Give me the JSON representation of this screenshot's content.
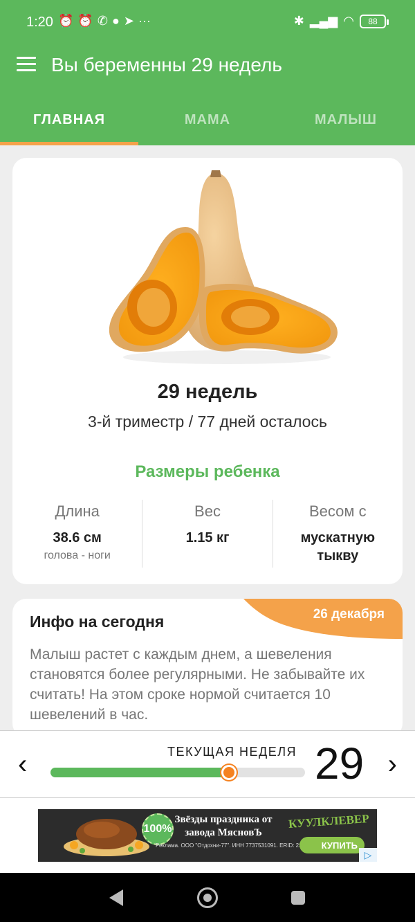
{
  "status_bar": {
    "time": "1:20",
    "left_icons": [
      "alarm-off-icon",
      "alarm-icon",
      "whatsapp-icon",
      "chat-bubble-icon",
      "telegram-icon",
      "more-dots-icon"
    ],
    "right_icons": [
      "bluetooth-icon",
      "signal-icon",
      "wifi-icon"
    ],
    "battery": "88"
  },
  "app_bar": {
    "title": "Вы беременны 29 недель",
    "tabs": [
      {
        "label": "ГЛАВНАЯ",
        "active": true
      },
      {
        "label": "МАМА",
        "active": false
      },
      {
        "label": "МАЛЫШ",
        "active": false
      }
    ]
  },
  "main_card": {
    "image_name": "butternut-squash-image",
    "week_title": "29 недель",
    "trimester_text": "3-й триместр / 77 дней осталось",
    "sizes_title": "Размеры ребенка",
    "metrics": [
      {
        "label": "Длина",
        "value": "38.6 см",
        "sub": "голова - ноги"
      },
      {
        "label": "Вес",
        "value": "1.15 кг",
        "sub": ""
      },
      {
        "label": "Весом с",
        "value_line1": "мускатную",
        "value_line2": "тыкву"
      }
    ]
  },
  "info_card": {
    "title": "Инфо на сегодня",
    "date": "26 декабря",
    "text": "Малыш растет с каждым днем, а шевеления становятся более регулярными. Не забывайте их считать! На этом сроке нормой считается 10 шевелений в час."
  },
  "week_selector": {
    "label": "ТЕКУЩАЯ НЕДЕЛЯ",
    "week": "29",
    "progress": 0.7,
    "prev_icon": "chevron-left-icon",
    "next_icon": "chevron-right-icon"
  },
  "ad": {
    "badge": "100%",
    "title": "Звёзды праздника от завода МясновЪ",
    "legal": "Реклама. ООО \"Отдохни-77\". ИНН 7737531091. ERID: 2SDnjcHpkD6",
    "brand": "КУУЛКЛЕВЕР",
    "cta": "КУПИТЬ"
  },
  "colors": {
    "primary_green": "#5cb85c",
    "accent_orange": "#f4a24a",
    "thumb_orange": "#f58220"
  }
}
